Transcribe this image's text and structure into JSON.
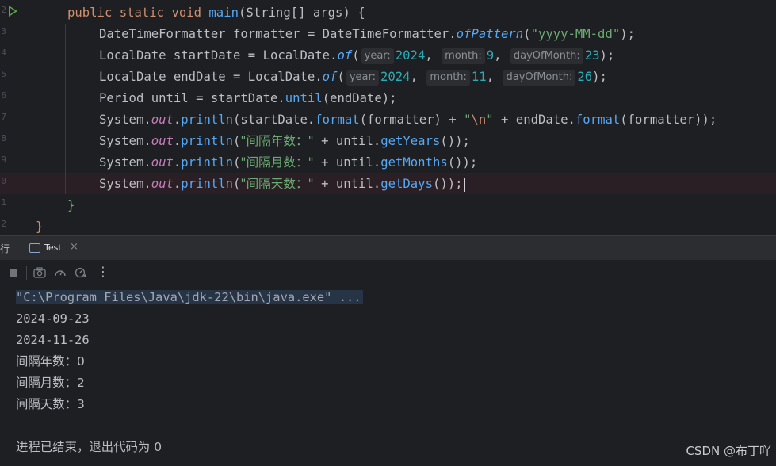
{
  "editor": {
    "line_numbers": [
      "2",
      "3",
      "4",
      "5",
      "6",
      "7",
      "8",
      "9",
      "0",
      "1",
      "2"
    ],
    "lines": {
      "l0": {
        "kw1": "public",
        "kw2": "static",
        "kw3": "void",
        "name": "main",
        "p1": "(",
        "type": "String[]",
        "param": "args",
        "p2": ")",
        "brace": "{"
      },
      "l1": {
        "cls": "DateTimeFormatter",
        "var": "formatter",
        "eq": "=",
        "cls2": "DateTimeFormatter",
        "dot": ".",
        "fn": "ofPattern",
        "open": "(",
        "str": "\"yyyy-MM-dd\"",
        "close": ");"
      },
      "l2": {
        "cls": "LocalDate",
        "var": "startDate",
        "eq": "=",
        "cls2": "LocalDate",
        "dot": ".",
        "fn": "of",
        "open": "(",
        "h1": "year:",
        "v1": "2024",
        "c1": ",",
        "h2": "month:",
        "v2": "9",
        "c2": ",",
        "h3": "dayOfMonth:",
        "v3": "23",
        "close": ");"
      },
      "l3": {
        "cls": "LocalDate",
        "var": "endDate",
        "eq": "=",
        "cls2": "LocalDate",
        "dot": ".",
        "fn": "of",
        "open": "(",
        "h1": "year:",
        "v1": "2024",
        "c1": ",",
        "h2": "month:",
        "v2": "11",
        "c2": ",",
        "h3": "dayOfMonth:",
        "v3": "26",
        "close": ");"
      },
      "l4": {
        "cls": "Period",
        "var": "until",
        "eq": "=",
        "obj": "startDate",
        "dot": ".",
        "fn": "until",
        "args": "(endDate);"
      },
      "l5": {
        "sys": "System",
        "d1": ".",
        "out": "out",
        "d2": ".",
        "fn": "println",
        "open": "(startDate.",
        "fn2": "format",
        "a1": "(formatter) + ",
        "q1": "\"",
        "esc": "\\n",
        "q2": "\"",
        "a2": " + endDate.",
        "fn3": "format",
        "a3": "(formatter));"
      },
      "l6": {
        "sys": "System",
        "d1": ".",
        "out": "out",
        "d2": ".",
        "fn": "println",
        "open": "(",
        "str": "\"间隔年数：\"",
        "mid": " + until.",
        "fn2": "getYears",
        "close": "());"
      },
      "l7": {
        "sys": "System",
        "d1": ".",
        "out": "out",
        "d2": ".",
        "fn": "println",
        "open": "(",
        "str": "\"间隔月数：\"",
        "mid": " + until.",
        "fn2": "getMonths",
        "close": "());"
      },
      "l8": {
        "sys": "System",
        "d1": ".",
        "out": "out",
        "d2": ".",
        "fn": "println",
        "open": "(",
        "str": "\"间隔天数：\"",
        "mid": " + until.",
        "fn2": "getDays",
        "close": "());"
      },
      "l9": {
        "brace": "}"
      },
      "l10": {
        "brace": "}"
      }
    }
  },
  "panel": {
    "tool_label": "行",
    "tab_label": "Test",
    "tab_close": "×",
    "more_label": "⋮"
  },
  "console": {
    "lines": [
      "\"C:\\Program Files\\Java\\jdk-22\\bin\\java.exe\" ...",
      "2024-09-23",
      "2024-11-26",
      "间隔年数：0",
      "间隔月数：2",
      "间隔天数：3",
      "",
      "进程已结束，退出代码为 0"
    ]
  },
  "watermark": "CSDN @布丁吖",
  "colors": {
    "background": "#1e1f22",
    "keyword": "#cf8e6d",
    "function": "#56a8f5",
    "string": "#6aab73",
    "number": "#2aacb8",
    "field": "#c77dbb",
    "accent": "#3574f0"
  },
  "icons": [
    "run-icon",
    "stop-icon",
    "camera-icon",
    "gauge-icon",
    "more-icon"
  ]
}
